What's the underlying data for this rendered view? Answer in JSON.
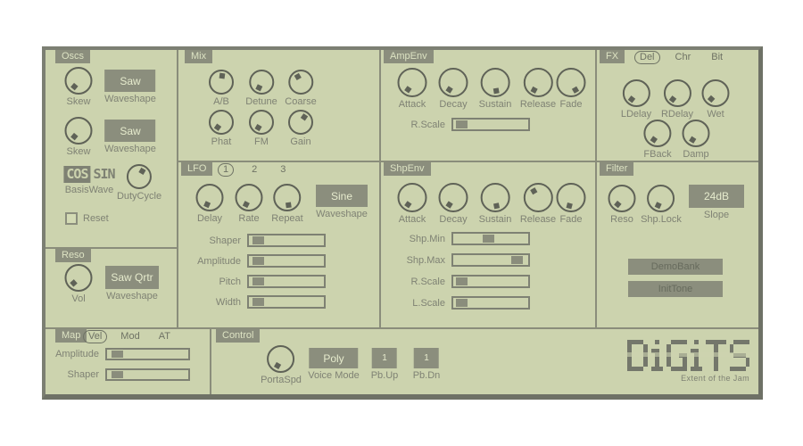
{
  "theme": {
    "panel_bg": "#ccd3ae",
    "button_bg": "#8b8e7d",
    "button_text": "#e6ebcd",
    "panel_line": "#8a8d7b",
    "label_text": "#7f8274",
    "knob_stroke": "#5f6257",
    "logo_color": "#74776b"
  },
  "oscs": {
    "title": "Oscs",
    "rows": [
      {
        "knob": {
          "label": "Skew",
          "angle": 220
        },
        "button": {
          "label": "Saw",
          "caption": "Waveshape"
        }
      },
      {
        "knob": {
          "label": "Skew",
          "angle": 220
        },
        "button": {
          "label": "Saw",
          "caption": "Waveshape"
        }
      }
    ],
    "basiswave": {
      "left": "cos",
      "right": "sin",
      "caption": "BasisWave"
    },
    "dutycycle": {
      "label": "DutyCycle",
      "angle": 30
    },
    "reset": {
      "label": "Reset",
      "checked": false
    }
  },
  "mix": {
    "title": "Mix",
    "knobs": [
      {
        "label": "A/B",
        "angle": 8
      },
      {
        "label": "Detune",
        "angle": 205
      },
      {
        "label": "Coarse",
        "angle": 330
      },
      {
        "label": "Phat",
        "angle": 215
      },
      {
        "label": "FM",
        "angle": 210
      },
      {
        "label": "Gain",
        "angle": 35
      }
    ]
  },
  "ampenv": {
    "title": "AmpEnv",
    "knobs": [
      {
        "label": "Attack",
        "angle": 215
      },
      {
        "label": "Decay",
        "angle": 213
      },
      {
        "label": "Sustain",
        "angle": 170
      },
      {
        "label": "Release",
        "angle": 208
      },
      {
        "label": "Fade",
        "angle": 150
      }
    ],
    "sliders": [
      {
        "label": "R.Scale",
        "value": 0.04
      }
    ]
  },
  "fx": {
    "title": "FX",
    "options": [
      {
        "label": "Del",
        "selected": true
      },
      {
        "label": "Chr",
        "selected": false
      },
      {
        "label": "Bit",
        "selected": false
      }
    ],
    "knobs": [
      {
        "label": "LDelay",
        "angle": 218
      },
      {
        "label": "RDelay",
        "angle": 218
      },
      {
        "label": "Wet",
        "angle": 222
      },
      {
        "label": "FBack",
        "angle": 215
      },
      {
        "label": "Damp",
        "angle": 212
      }
    ]
  },
  "lfo": {
    "title": "LFO",
    "options": [
      {
        "label": "1",
        "selected": true
      },
      {
        "label": "2",
        "selected": false
      },
      {
        "label": "3",
        "selected": false
      }
    ],
    "knobs": [
      {
        "label": "Delay",
        "angle": 205
      },
      {
        "label": "Rate",
        "angle": 207
      },
      {
        "label": "Repeat",
        "angle": 172
      }
    ],
    "waveshape": {
      "label": "Sine",
      "caption": "Waveshape"
    },
    "sliders": [
      {
        "label": "Shaper",
        "value": 0.06
      },
      {
        "label": "Amplitude",
        "value": 0.06
      },
      {
        "label": "Pitch",
        "value": 0.05
      },
      {
        "label": "Width",
        "value": 0.05
      }
    ]
  },
  "shpenv": {
    "title": "ShpEnv",
    "knobs": [
      {
        "label": "Attack",
        "angle": 215
      },
      {
        "label": "Decay",
        "angle": 213
      },
      {
        "label": "Sustain",
        "angle": 168
      },
      {
        "label": "Release",
        "angle": 330
      },
      {
        "label": "Fade",
        "angle": 195
      }
    ],
    "sliders": [
      {
        "label": "Shp.Min",
        "value": 0.47
      },
      {
        "label": "Shp.Max",
        "value": 0.91
      },
      {
        "label": "R.Scale",
        "value": 0.04
      },
      {
        "label": "L.Scale",
        "value": 0.04
      }
    ]
  },
  "filter": {
    "title": "Filter",
    "knobs": [
      {
        "label": "Reso",
        "angle": 220
      },
      {
        "label": "Shp.Lock",
        "angle": 205
      }
    ],
    "slope": {
      "label": "24dB",
      "caption": "Slope"
    },
    "buttons": [
      {
        "label": "DemoBank"
      },
      {
        "label": "InitTone"
      }
    ]
  },
  "reso": {
    "title": "Reso",
    "knob": {
      "label": "Vol",
      "angle": 228
    },
    "waveshape": {
      "label": "Saw Qrtr",
      "caption": "Waveshape"
    }
  },
  "map": {
    "title": "Map",
    "options": [
      {
        "label": "Vel",
        "selected": true
      },
      {
        "label": "Mod",
        "selected": false
      },
      {
        "label": "AT",
        "selected": false
      }
    ],
    "sliders": [
      {
        "label": "Amplitude",
        "value": 0.06
      },
      {
        "label": "Shaper",
        "value": 0.06
      }
    ]
  },
  "control": {
    "title": "Control",
    "knob": {
      "label": "PortaSpd",
      "angle": 210
    },
    "voice_mode": {
      "label": "Poly",
      "caption": "Voice Mode"
    },
    "pb_up": {
      "label": "1",
      "caption": "Pb.Up"
    },
    "pb_dn": {
      "label": "1",
      "caption": "Pb.Dn"
    }
  },
  "logo": {
    "text": "DiGiTS",
    "tagline": "Extent of the Jam"
  }
}
